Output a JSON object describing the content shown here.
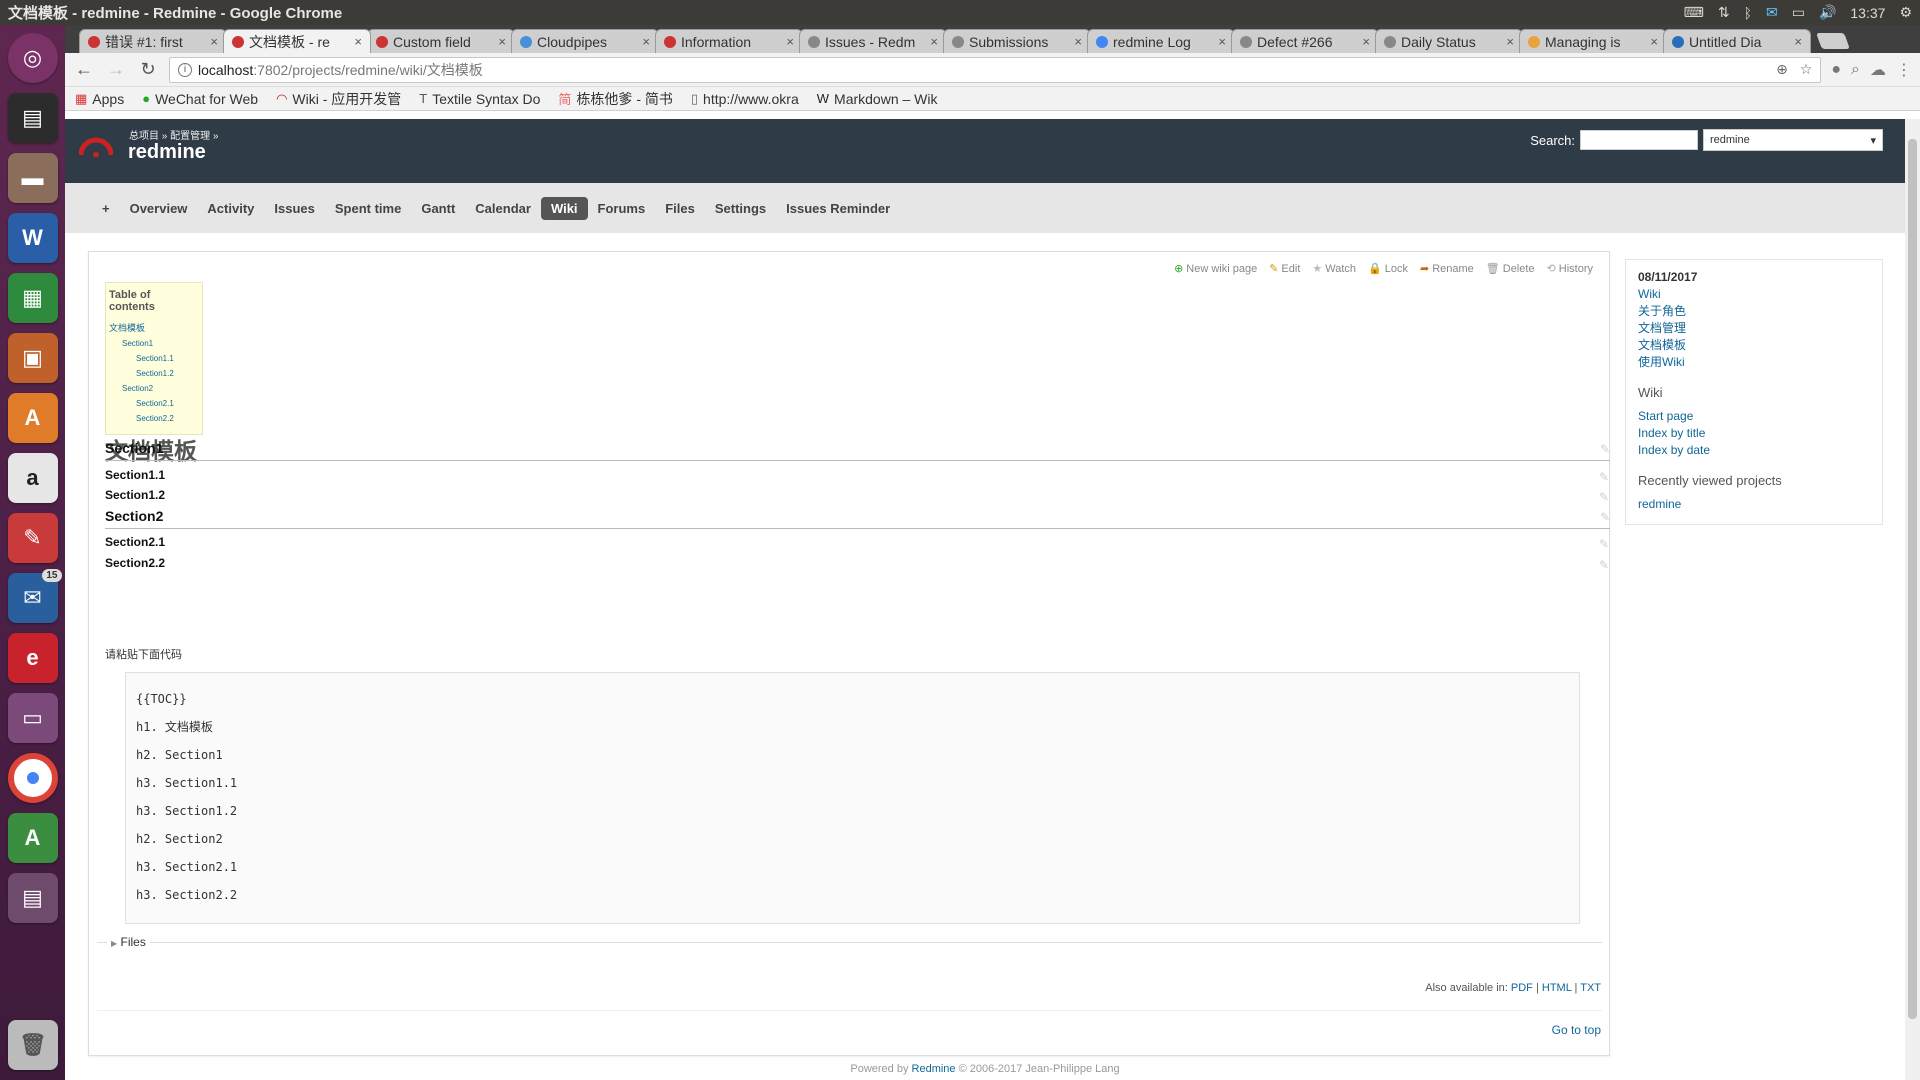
{
  "os_panel": {
    "window_title": "文档模板 - redmine - Redmine - Google Chrome",
    "clock": "13:37"
  },
  "launcher": {
    "thunderbird_badge": "15"
  },
  "browser": {
    "tabs": [
      {
        "title": "错误 #1: first",
        "fav": "#c33"
      },
      {
        "title": "文档模板 - re",
        "fav": "#c33"
      },
      {
        "title": "Custom field",
        "fav": "#c33"
      },
      {
        "title": "Cloudpipes",
        "fav": "#4a90d9"
      },
      {
        "title": "Information",
        "fav": "#c33"
      },
      {
        "title": "Issues - Redm",
        "fav": "#888"
      },
      {
        "title": "Submissions",
        "fav": "#888"
      },
      {
        "title": "redmine Log",
        "fav": "#4285f4"
      },
      {
        "title": "Defect #266",
        "fav": "#888"
      },
      {
        "title": "Daily Status",
        "fav": "#888"
      },
      {
        "title": "Managing is",
        "fav": "#e8a33d"
      },
      {
        "title": "Untitled Dia",
        "fav": "#2a6ebb"
      }
    ],
    "url_host": "localhost",
    "url_path": ":7802/projects/redmine/wiki/文档模板",
    "bookmarks": [
      {
        "label": "Apps",
        "icon": "apps-icon"
      },
      {
        "label": "WeChat for Web",
        "icon": "wechat-icon"
      },
      {
        "label": "Wiki - 应用开发管",
        "icon": "redmine-icon"
      },
      {
        "label": "Textile Syntax Do",
        "icon": "textile-icon"
      },
      {
        "label": "栋栋他爹 - 简书",
        "icon": "jianshu-icon"
      },
      {
        "label": "http://www.okra",
        "icon": "page-icon"
      },
      {
        "label": "Markdown – Wik",
        "icon": "wikipedia-icon"
      }
    ]
  },
  "redmine": {
    "breadcrumb": "总项目 » 配置管理 »",
    "project": "redmine",
    "search_label": "Search:",
    "search_placeholder": "",
    "search_scope": "redmine",
    "menu": [
      "+",
      "Overview",
      "Activity",
      "Issues",
      "Spent time",
      "Gantt",
      "Calendar",
      "Wiki",
      "Forums",
      "Files",
      "Settings",
      "Issues Reminder"
    ],
    "menu_selected": "Wiki",
    "contextual": [
      "New wiki page",
      "Edit",
      "Watch",
      "Lock",
      "Rename",
      "Delete",
      "History"
    ],
    "toc": {
      "title": "Table of contents",
      "items": [
        {
          "label": "文档模板",
          "level": 1
        },
        {
          "label": "Section1",
          "level": 2
        },
        {
          "label": "Section1.1",
          "level": 3
        },
        {
          "label": "Section1.2",
          "level": 3
        },
        {
          "label": "Section2",
          "level": 2
        },
        {
          "label": "Section2.1",
          "level": 3
        },
        {
          "label": "Section2.2",
          "level": 3
        }
      ]
    },
    "page_title": "文档模板",
    "headings": [
      {
        "text": "Section1",
        "level": 2
      },
      {
        "text": "Section1.1",
        "level": 3
      },
      {
        "text": "Section1.2",
        "level": 3
      },
      {
        "text": "Section2",
        "level": 2
      },
      {
        "text": "Section2.1",
        "level": 3
      },
      {
        "text": "Section2.2",
        "level": 3
      }
    ],
    "paste_note": "请粘贴下面代码",
    "code_lines": [
      "{{TOC}}",
      "h1. 文档模板",
      "h2. Section1",
      "h3. Section1.1",
      "h3. Section1.2",
      "h2. Section2",
      "h3. Section2.1",
      "h3. Section2.2"
    ],
    "files_label": "Files",
    "also_available": "Also available in:",
    "formats": [
      "PDF",
      "HTML",
      "TXT"
    ],
    "go_top": "Go to top",
    "sidebar": {
      "date": "08/11/2017",
      "recent": [
        "Wiki",
        "关于角色",
        "文档管理",
        "文档模板",
        "使用Wiki"
      ],
      "wiki_title": "Wiki",
      "wiki_links": [
        "Start page",
        "Index by title",
        "Index by date"
      ],
      "recent_projects_title": "Recently viewed projects",
      "recent_projects": [
        "redmine"
      ]
    },
    "footer_prefix": "Powered by",
    "footer_link": "Redmine",
    "footer_suffix": "© 2006-2017 Jean-Philippe Lang"
  }
}
